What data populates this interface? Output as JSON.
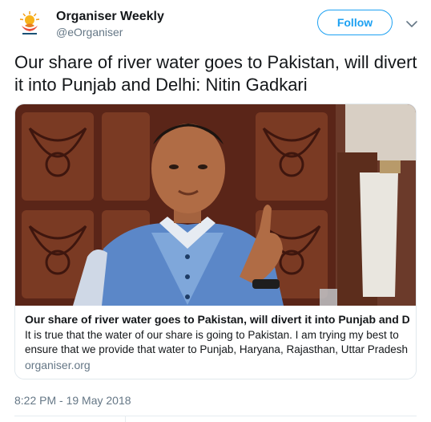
{
  "account": {
    "display_name": "Organiser Weekly",
    "handle": "@eOrganiser",
    "avatar_icon": "organiser-lotus-logo"
  },
  "actions": {
    "follow_label": "Follow",
    "more_icon": "chevron-down-icon"
  },
  "tweet": {
    "text": "Our share of river water goes to Pakistan, will divert it into Punjab and Delhi: Nitin Gadkari",
    "timestamp": "8:22 PM - 19 May 2018"
  },
  "card": {
    "title": "Our share of river water goes to Pakistan, will divert it into Punjab and Delhi: ...",
    "description_line1": "It is true that the water of our share is going to Pakistan. I am trying my best to",
    "description_line2": "ensure that we provide that water to Punjab, Haryana, Rajasthan, Uttar Pradesh a...",
    "domain": "organiser.org"
  },
  "colors": {
    "accent": "#1da1f2",
    "text_primary": "#14171a",
    "text_secondary": "#657786",
    "border": "#e1e8ed"
  }
}
